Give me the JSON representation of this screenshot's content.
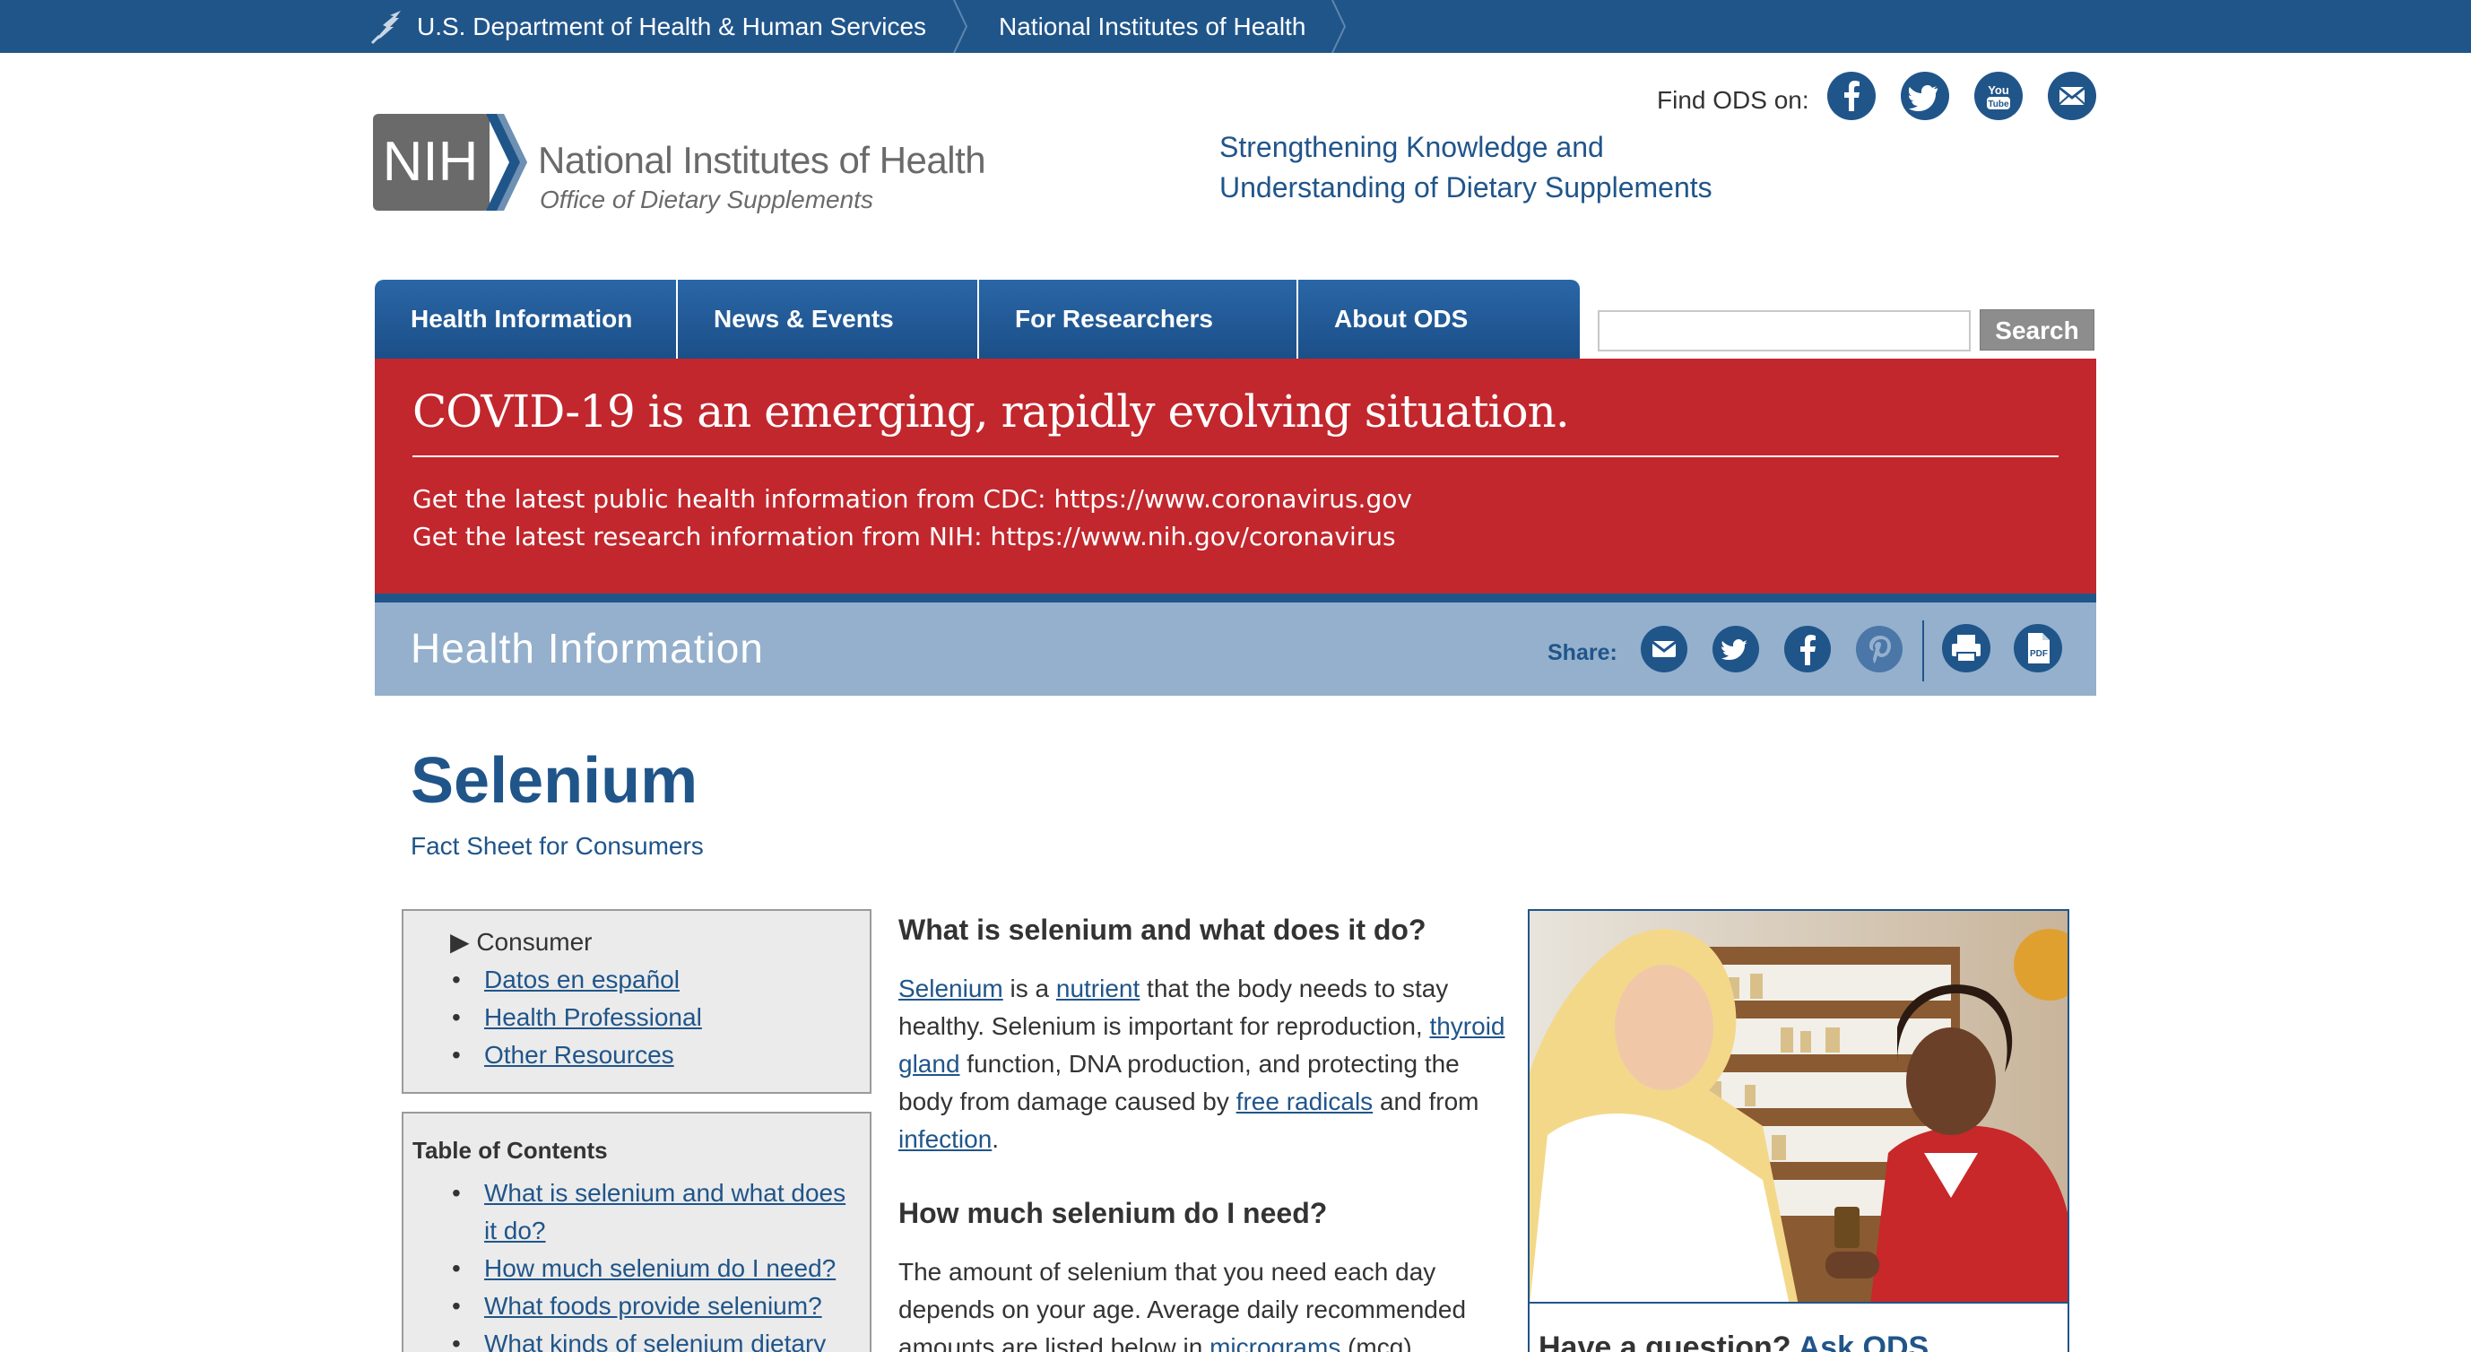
{
  "topbar": {
    "hhs_label": "U.S. Department of Health & Human Services",
    "nih_label": "National Institutes of Health"
  },
  "header": {
    "logo_line1": "National Institutes of Health",
    "logo_line2": "Office of Dietary Supplements",
    "logo_mark_text": "NIH",
    "tagline_line1": "Strengthening Knowledge and",
    "tagline_line2": "Understanding of Dietary Supplements",
    "find_ods": "Find ODS on:",
    "social": [
      "facebook-icon",
      "twitter-icon",
      "youtube-icon",
      "email-icon"
    ]
  },
  "nav": {
    "tabs": [
      "Health Information",
      "News & Events",
      "For Researchers",
      "About ODS"
    ]
  },
  "search": {
    "value": "",
    "button_label": "Search"
  },
  "covid": {
    "headline": "COVID-19 is an emerging, rapidly evolving situation.",
    "line1": "Get the latest public health information from CDC: https://www.coronavirus.gov",
    "line2": "Get the latest research information from NIH: https://www.nih.gov/coronavirus"
  },
  "section": {
    "title": "Health Information",
    "share_label": "Share:"
  },
  "page": {
    "title": "Selenium",
    "subtitle": "Fact Sheet for Consumers"
  },
  "versions": {
    "current": "Consumer",
    "links": [
      "Datos en español",
      "Health Professional",
      "Other Resources"
    ]
  },
  "toc": {
    "title": "Table of Contents",
    "items": [
      "What is selenium and what does it do?",
      "How much selenium do I need?",
      "What foods provide selenium?",
      "What kinds of selenium dietary"
    ]
  },
  "main": {
    "q1": "What is selenium and what does it do?",
    "p1": {
      "selenium": "Selenium",
      "t1": " is a ",
      "nutrient": "nutrient",
      "t2": " that the body needs to stay healthy. Selenium is important for reproduction, ",
      "thyroid": "thyroid gland",
      "t3": " function, DNA production, and protecting the body from damage caused by ",
      "radicals": "free radicals",
      "t4": " and from ",
      "infection": "infection",
      "t5": "."
    },
    "q2": "How much selenium do I need?",
    "p2": {
      "t1": "The amount of selenium that you need each day depends on your age. Average daily recommended amounts are listed below in ",
      "micrograms": "micrograms",
      "t2": " (mcg)."
    }
  },
  "aside": {
    "ask_prefix": "Have a question? ",
    "ask_link": "Ask ODS"
  }
}
